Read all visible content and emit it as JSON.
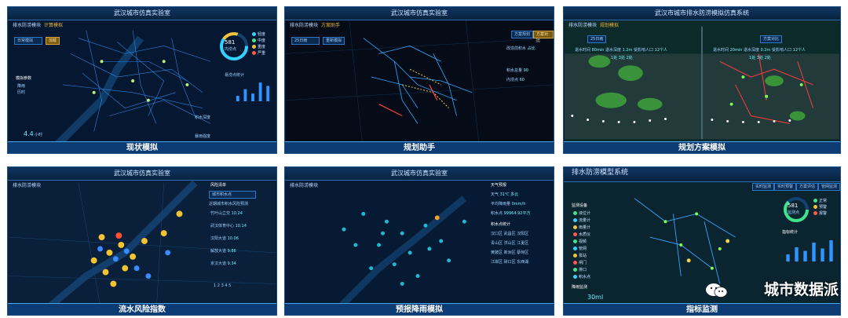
{
  "panels": [
    {
      "title": "武汉城市仿真实验室",
      "module": "排水防涝模块",
      "sub": "计算模拟",
      "controls": [
        "日常模拟",
        "加载"
      ],
      "gauge_value": "581",
      "gauge_unit": "内涝点",
      "legend": [
        "轻度",
        "中度",
        "重度",
        "严重"
      ],
      "left_box": {
        "title": "模拟参数",
        "items": [
          "降雨",
          "历时"
        ],
        "value": "4.4",
        "unit": "小时"
      },
      "side_text": [
        "易涝点统计",
        "积水深度",
        "暴雨强度"
      ],
      "bar_values": [
        0.25,
        0.55,
        0.35,
        0.85,
        0.7
      ],
      "caption": "现状模拟"
    },
    {
      "title": "武汉城市仿真实验室",
      "module": "排水防涝模块",
      "sub": "方案助手",
      "controls": [
        "25日雨",
        "重新模拟"
      ],
      "buttons": [
        "方案规划",
        "方案对比"
      ],
      "kv": [
        [
          "改造前积水",
          "占比"
        ],
        [
          "积水总量",
          "90"
        ],
        [
          "内涝点",
          "60"
        ]
      ],
      "caption": "规划助手"
    },
    {
      "title": "武汉市城市排水防涝模拟仿真系统",
      "module": "排水防涝模块",
      "sub": "规划模拟",
      "controls": [
        "25日雨",
        "方案对比"
      ],
      "stats_left": {
        "label1": "退水时间",
        "v1": "80min",
        "label2": "退水深度",
        "v2": "1.2m",
        "label3": "受影响人口",
        "v3": "12个人"
      },
      "stats_right": {
        "label1": "退水时间",
        "v1": "20min",
        "label2": "退水深度",
        "v2": "0.2m",
        "label3": "受影响人口",
        "v3": "12个人"
      },
      "counts_left": [
        "1处",
        "3处",
        "2处"
      ],
      "counts_right": [
        "1处",
        "3处",
        "2处"
      ],
      "caption": "规划方案模拟"
    },
    {
      "title": "武汉城市仿真实验室",
      "module": "排水防涝模块",
      "list_title": "风险清单",
      "select": "城市积水点",
      "list_header": "近期城市积水风险预测",
      "list": [
        {
          "name": "竹叶山立交",
          "risk": "10.24"
        },
        {
          "name": "武汉体育中心",
          "risk": "10.14"
        },
        {
          "name": "汉阳大道",
          "risk": "10.06"
        },
        {
          "name": "解放大道",
          "risk": "9.86"
        },
        {
          "name": "京汉大道",
          "risk": "9.34"
        }
      ],
      "pages": [
        "1",
        "2",
        "3",
        "4",
        "5"
      ],
      "caption": "流水风险指数"
    },
    {
      "title": "武汉城市仿真实验室",
      "module": "排水防涝模块",
      "panel_title": "天气预报",
      "weather": [
        [
          "天气",
          "31℃ 多云"
        ],
        [
          "平均降雨量",
          "0mm/h"
        ],
        [
          "积水点",
          "99964.92平方"
        ]
      ],
      "table_title": "积水点统计",
      "grid": [
        "汉口区",
        "武昌区",
        "汉阳区",
        "青山区",
        "洪山区",
        "江夏区",
        "黄陂区",
        "新洲区",
        "蔡甸区",
        "江岸区",
        "硚口区",
        "东西湖"
      ],
      "caption": "预报降雨模拟"
    },
    {
      "title": "排水防涝模型系统",
      "tabs": [
        "实时监测",
        "实时预警",
        "方案评估",
        "管网监测"
      ],
      "left_title": "监测设备",
      "left_items": [
        "液位计",
        "流量计",
        "雨量计",
        "水质仪",
        "视频",
        "管网",
        "泵站",
        "闸门",
        "排口",
        "积水点"
      ],
      "gauge_value": "581",
      "gauge_unit": "监测点",
      "legend": [
        "正常",
        "预警",
        "报警"
      ],
      "side_title": "指标统计",
      "bar_values": [
        0.3,
        0.6,
        0.45,
        0.8,
        0.55,
        0.9
      ],
      "bottom_title": "降雨监测",
      "bottom_value": "30ml",
      "caption": "指标监测"
    }
  ],
  "watermark": "城市数据派",
  "colors": {
    "accent": "#47a6ff",
    "gold": "#e9b33a",
    "caption_bg": "#0d3b73",
    "map_bg": "#071a33"
  }
}
